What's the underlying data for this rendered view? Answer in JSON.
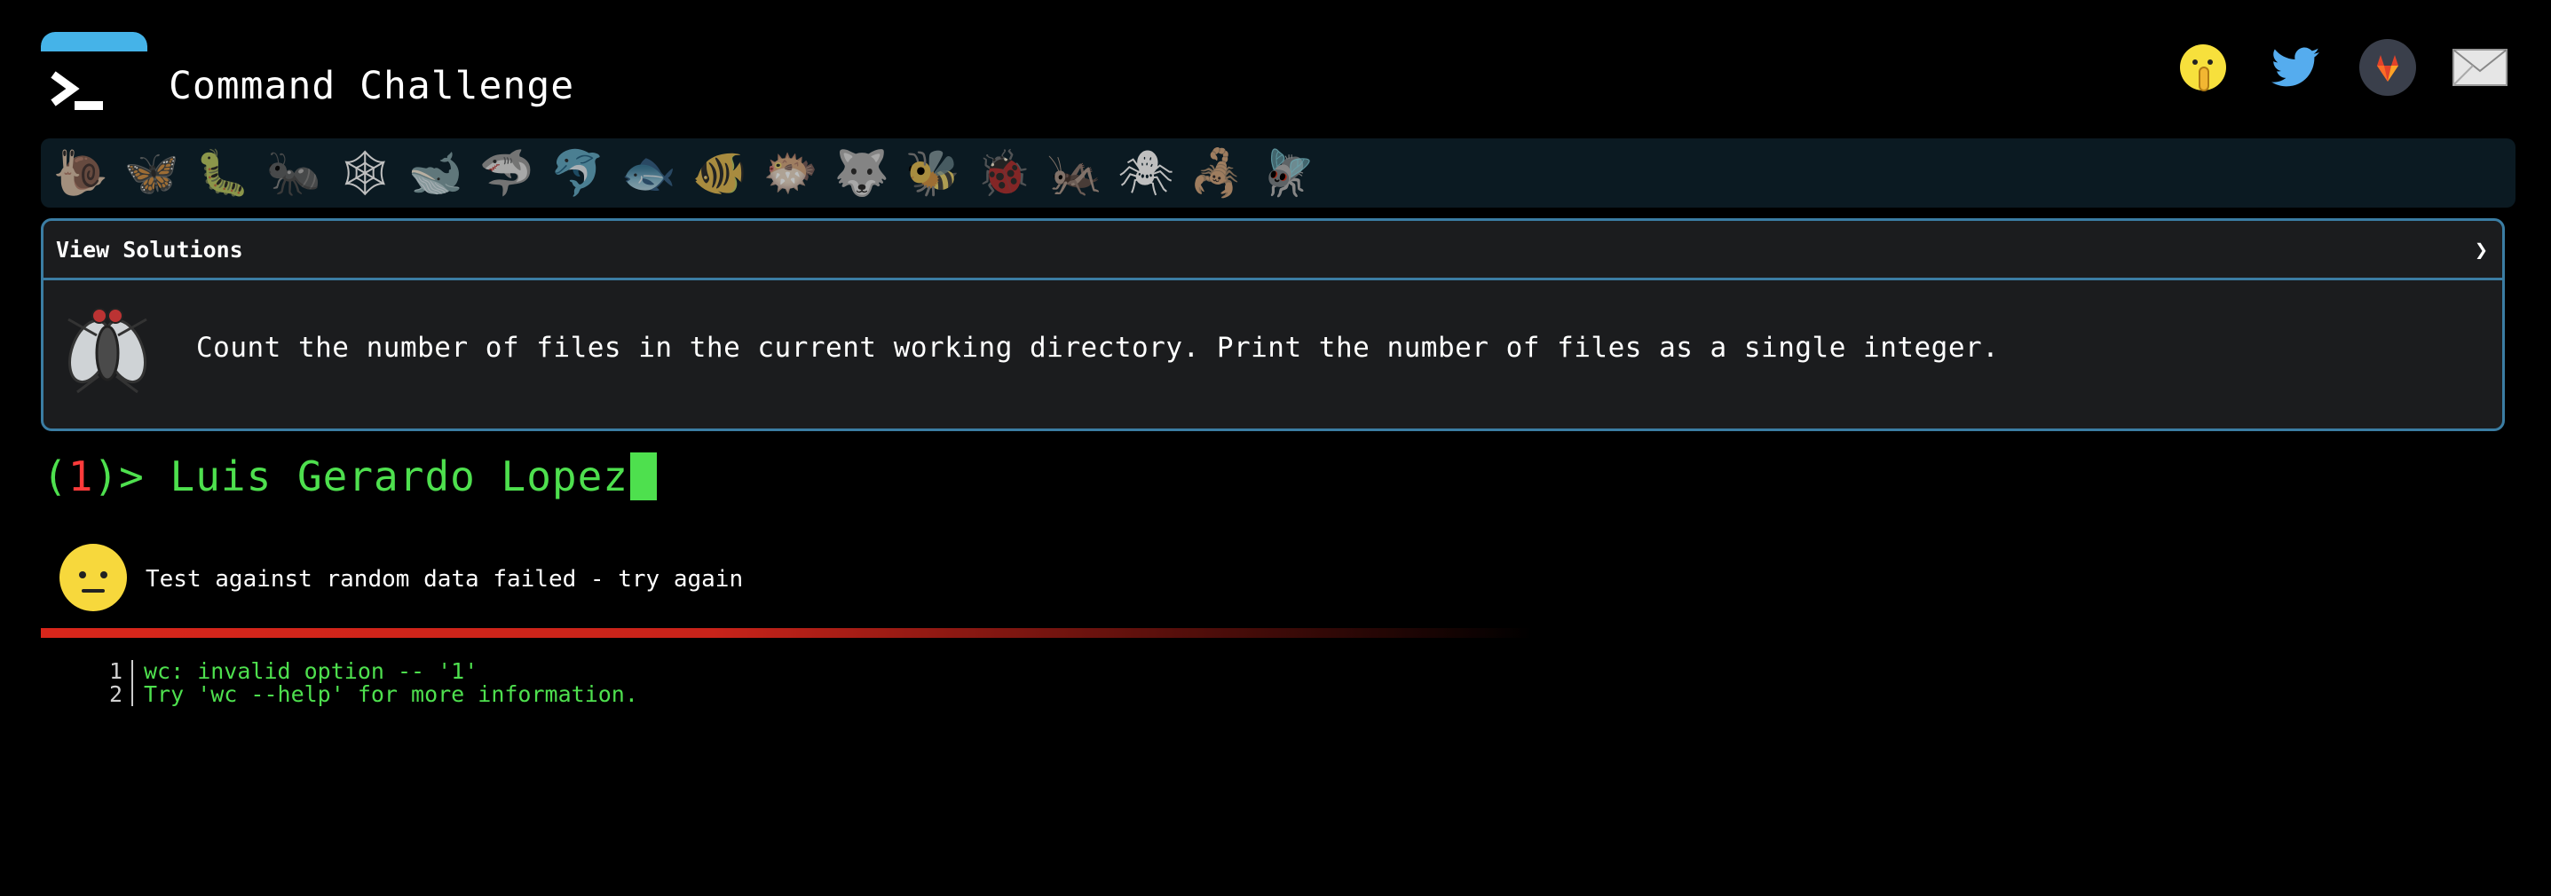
{
  "header": {
    "title": "Command Challenge",
    "social": [
      {
        "icon": "shush-face-icon"
      },
      {
        "icon": "twitter-icon"
      },
      {
        "icon": "gitlab-icon"
      },
      {
        "icon": "mail-icon"
      }
    ]
  },
  "animals": [
    {
      "icon": "snail-icon",
      "glyph": "🐌"
    },
    {
      "icon": "butterfly-icon",
      "glyph": "🦋"
    },
    {
      "icon": "caterpillar-icon",
      "glyph": "🐛"
    },
    {
      "icon": "ant-icon",
      "glyph": "🐜"
    },
    {
      "icon": "spider-web-icon",
      "glyph": "🕸"
    },
    {
      "icon": "whale-icon",
      "glyph": "🐋"
    },
    {
      "icon": "shark-icon",
      "glyph": "🦈"
    },
    {
      "icon": "dolphin-icon",
      "glyph": "🐬"
    },
    {
      "icon": "fish-icon",
      "glyph": "🐟"
    },
    {
      "icon": "tropical-fish-icon",
      "glyph": "🐠"
    },
    {
      "icon": "blowfish-icon",
      "glyph": "🐡"
    },
    {
      "icon": "wolf-icon",
      "glyph": "🐺"
    },
    {
      "icon": "bee-icon",
      "glyph": "🐝"
    },
    {
      "icon": "ladybug-icon",
      "glyph": "🐞"
    },
    {
      "icon": "cricket-icon",
      "glyph": "🦗"
    },
    {
      "icon": "spider-icon",
      "glyph": "🕷"
    },
    {
      "icon": "scorpion-icon",
      "glyph": "🦂"
    },
    {
      "icon": "fly-icon",
      "glyph": "🪰"
    }
  ],
  "panel": {
    "header_label": "View Solutions",
    "chevron": "❯",
    "task": "Count the number of files in the current working directory. Print the number of files as a single integer."
  },
  "prompt": {
    "open": "(",
    "number": "1",
    "close": ")> ",
    "input": "Luis Gerardo Lopez"
  },
  "result": {
    "icon": "neutral-face-icon",
    "message": "Test against random data failed - try again"
  },
  "output": [
    {
      "n": "1",
      "text": "wc: invalid option -- '1'"
    },
    {
      "n": "2",
      "text": "Try 'wc --help' for more information."
    }
  ],
  "colors": {
    "accent": "#45b3e8",
    "panel_border": "#3b7da3",
    "prompt_green": "#4ee04e",
    "error_red": "#d8261b"
  }
}
